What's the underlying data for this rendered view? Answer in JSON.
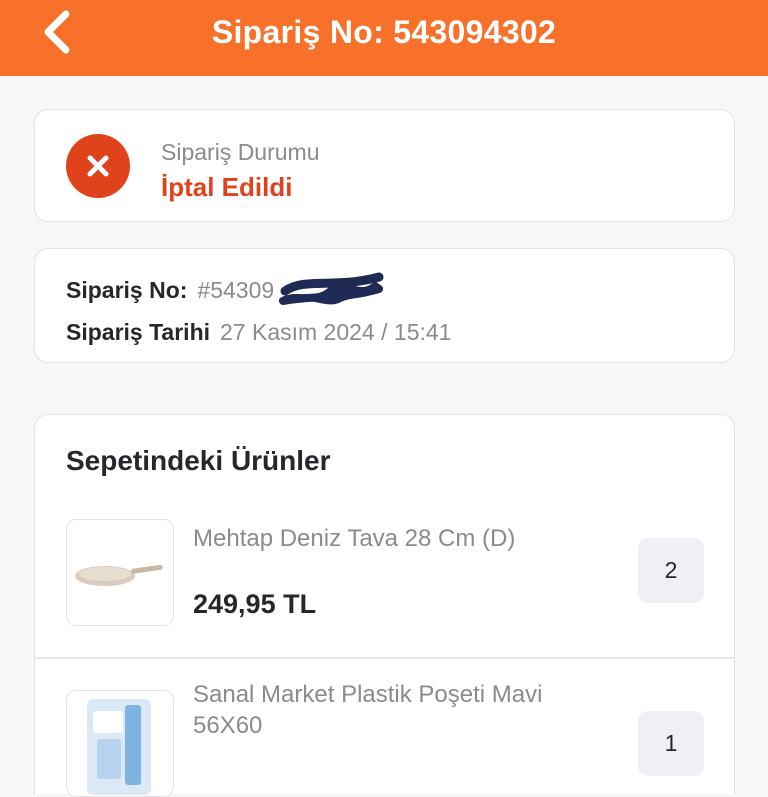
{
  "header": {
    "title": "Sipariş No: 543094302"
  },
  "status": {
    "label": "Sipariş Durumu",
    "value": "İptal Edildi",
    "icon": "cancel-x-icon",
    "color": "#e0431b"
  },
  "order_info": {
    "order_no_label": "Sipariş No:",
    "order_no_value": "#54309",
    "date_label": "Sipariş Tarihi",
    "date_value": "27 Kasım 2024 / 15:41"
  },
  "cart": {
    "title": "Sepetindeki Ürünler",
    "items": [
      {
        "name": "Mehtap Deniz Tava 28 Cm (D)",
        "price": "249,95 TL",
        "quantity": "2",
        "image": "frying-pan-image"
      },
      {
        "name": "Sanal Market Plastik Poşeti Mavi 56X60",
        "price": "",
        "quantity": "1",
        "image": "plastic-bag-image"
      }
    ]
  },
  "colors": {
    "brand": "#f7712a",
    "cancel": "#e0431b"
  }
}
